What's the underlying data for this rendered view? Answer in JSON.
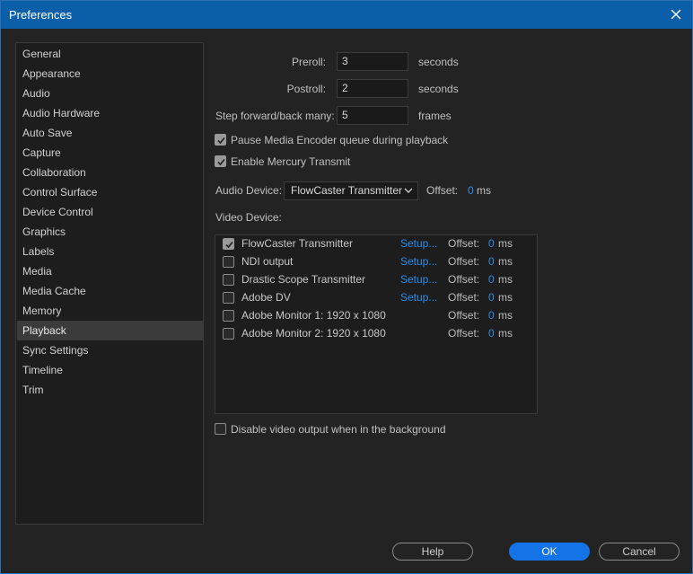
{
  "window": {
    "title": "Preferences"
  },
  "sidebar": {
    "items": [
      {
        "label": "General"
      },
      {
        "label": "Appearance"
      },
      {
        "label": "Audio"
      },
      {
        "label": "Audio Hardware"
      },
      {
        "label": "Auto Save"
      },
      {
        "label": "Capture"
      },
      {
        "label": "Collaboration"
      },
      {
        "label": "Control Surface"
      },
      {
        "label": "Device Control"
      },
      {
        "label": "Graphics"
      },
      {
        "label": "Labels"
      },
      {
        "label": "Media"
      },
      {
        "label": "Media Cache"
      },
      {
        "label": "Memory"
      },
      {
        "label": "Playback"
      },
      {
        "label": "Sync Settings"
      },
      {
        "label": "Timeline"
      },
      {
        "label": "Trim"
      }
    ],
    "selected": "Playback"
  },
  "playback": {
    "preroll": {
      "label": "Preroll:",
      "value": "3",
      "unit": "seconds"
    },
    "postroll": {
      "label": "Postroll:",
      "value": "2",
      "unit": "seconds"
    },
    "step": {
      "label": "Step forward/back many:",
      "value": "5",
      "unit": "frames"
    },
    "pause_encoder": {
      "label": "Pause Media Encoder queue during playback",
      "checked": true
    },
    "mercury_transmit": {
      "label": "Enable Mercury Transmit",
      "checked": true
    },
    "audio_device": {
      "label": "Audio Device:",
      "value": "FlowCaster Transmitter",
      "offset_label": "Offset:",
      "offset_value": "0",
      "offset_unit": "ms"
    },
    "video_device_label": "Video Device:",
    "video_devices": [
      {
        "name": "FlowCaster Transmitter",
        "checked": true,
        "setup": "Setup...",
        "offset_label": "Offset:",
        "offset_value": "0",
        "offset_unit": "ms"
      },
      {
        "name": "NDI output",
        "checked": false,
        "setup": "Setup...",
        "offset_label": "Offset:",
        "offset_value": "0",
        "offset_unit": "ms"
      },
      {
        "name": "Drastic Scope Transmitter",
        "checked": false,
        "setup": "Setup...",
        "offset_label": "Offset:",
        "offset_value": "0",
        "offset_unit": "ms"
      },
      {
        "name": "Adobe DV",
        "checked": false,
        "setup": "Setup...",
        "offset_label": "Offset:",
        "offset_value": "0",
        "offset_unit": "ms"
      },
      {
        "name": "Adobe Monitor 1: 1920 x 1080",
        "checked": false,
        "setup": "",
        "offset_label": "Offset:",
        "offset_value": "0",
        "offset_unit": "ms"
      },
      {
        "name": "Adobe Monitor 2: 1920 x 1080",
        "checked": false,
        "setup": "",
        "offset_label": "Offset:",
        "offset_value": "0",
        "offset_unit": "ms"
      }
    ],
    "disable_bg": {
      "label": "Disable video output when in the background",
      "checked": false
    }
  },
  "footer": {
    "help": "Help",
    "ok": "OK",
    "cancel": "Cancel"
  },
  "colors": {
    "title_bar": "#0b5fa8",
    "accent": "#1473e6",
    "link": "#2d8ceb"
  },
  "icons": [
    "close-icon",
    "checkmark-icon",
    "chevron-down-icon"
  ]
}
